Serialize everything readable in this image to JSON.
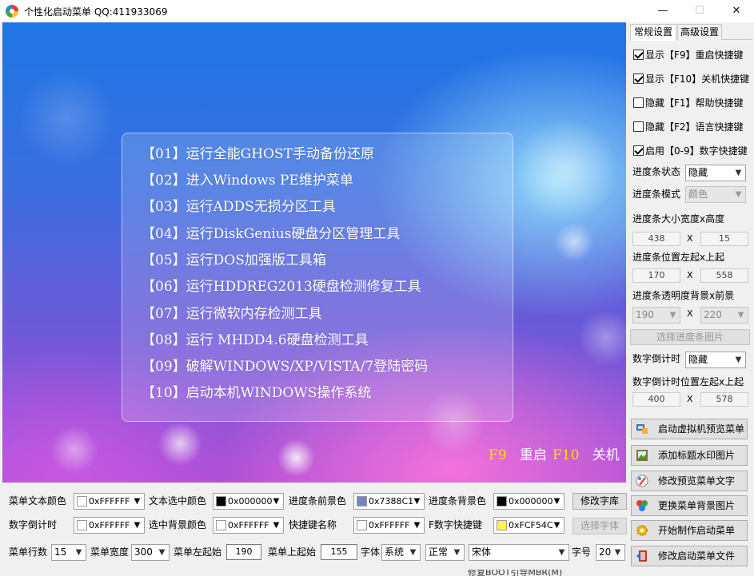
{
  "window": {
    "title": "个性化启动菜单 QQ:411933069"
  },
  "preview": {
    "menu_items": [
      "【01】运行全能GHOST手动备份还原",
      "【02】进入Windows PE维护菜单",
      "【03】运行ADDS无损分区工具",
      "【04】运行DiskGenius硬盘分区管理工具",
      "【05】运行DOS加强版工具箱",
      "【06】运行HDDREG2013硬盘检测修复工具",
      "【07】运行微软内存检测工具",
      "【08】运行 MHDD4.6硬盘检测工具",
      "【09】破解WINDOWS/XP/VISTA/7登陆密码",
      "【10】启动本机WINDOWS操作系统"
    ],
    "hotkeys": {
      "f9_key": "F9",
      "f9_label": "重启",
      "f10_key": "F10",
      "f10_label": "关机"
    },
    "colors": {
      "menu_text": "#FFFFFF",
      "hotkey": "#FFE000"
    }
  },
  "tabs": [
    "常规设置",
    "高级设置"
  ],
  "checkboxes": [
    {
      "label": "显示【F9】重启快捷键",
      "checked": true
    },
    {
      "label": "显示【F10】关机快捷键",
      "checked": true
    },
    {
      "label": "隐藏【F1】帮助快捷键",
      "checked": false
    },
    {
      "label": "隐藏【F2】语言快捷键",
      "checked": false
    },
    {
      "label": "启用【0-9】数字快捷键",
      "checked": true
    }
  ],
  "progress": {
    "state_label": "进度条状态",
    "state_value": "隐藏",
    "mode_label": "进度条模式",
    "mode_value": "颜色",
    "size_label": "进度条大小宽度x高度",
    "width": "438",
    "height": "15",
    "pos_label": "进度条位置左起x上起",
    "left": "170",
    "top": "558",
    "alpha_label": "进度条透明度背景x前景",
    "alpha_bg": "190",
    "alpha_fg": "220",
    "x": "X",
    "image_button": "选择进度条图片"
  },
  "countdown": {
    "label": "数字倒计时",
    "value": "隐藏",
    "pos_label": "数字倒计时位置左起x上起",
    "left": "400",
    "top": "578",
    "x": "X"
  },
  "actions": [
    {
      "label": "启动虚拟机预览菜单",
      "icon": "virtual-machine-icon"
    },
    {
      "label": "添加标题水印图片",
      "icon": "watermark-image-icon"
    },
    {
      "label": "修改预览菜单文字",
      "icon": "edit-text-icon"
    },
    {
      "label": "更换菜单背景图片",
      "icon": "background-image-icon"
    },
    {
      "label": "开始制作启动菜单",
      "icon": "gear-icon"
    },
    {
      "label": "修改启动菜单文件",
      "icon": "exit-door-icon"
    }
  ],
  "bottom": {
    "menu_text_color_label": "菜单文本颜色",
    "menu_text_color": "0xFFFFFF",
    "menu_text_color_hex": "#FFFFFF",
    "text_sel_color_label": "文本选中颜色",
    "text_sel_color": "0x000000",
    "text_sel_color_hex": "#000000",
    "progress_fg_label": "进度条前景色",
    "progress_fg": "0x7388C1",
    "progress_fg_hex": "#7388C1",
    "progress_bg_label": "进度条背景色",
    "progress_bg": "0x000000",
    "progress_bg_hex": "#000000",
    "font_lib_button": "修改字库",
    "countdown_label": "数字倒计时",
    "countdown_color": "0xFFFFFF",
    "countdown_color_hex": "#FFFFFF",
    "sel_bg_label": "选中背景颜色",
    "sel_bg_color": "0xFFFFFF",
    "sel_bg_color_hex": "#FFFFFF",
    "hotkey_name_label": "快捷键名称",
    "hotkey_name_color": "0xFFFFFF",
    "hotkey_name_color_hex": "#FFFFFF",
    "fkey_label": "F数字快捷键",
    "fkey_color": "0xFCF54C",
    "fkey_color_hex": "#FCF54C",
    "select_font_button": "选择字体",
    "rows_label": "菜单行数",
    "rows": "15",
    "width_label": "菜单宽度",
    "width": "300",
    "left_label": "菜单左起始",
    "left": "190",
    "top_label": "菜单上起始",
    "top": "155",
    "font_label": "字体",
    "font_set": "系统",
    "font_style": "正常",
    "font_name": "宋体",
    "size_label": "字号",
    "size": "20"
  },
  "taskbar_peek": "修复BOOT引导MBR(M)"
}
